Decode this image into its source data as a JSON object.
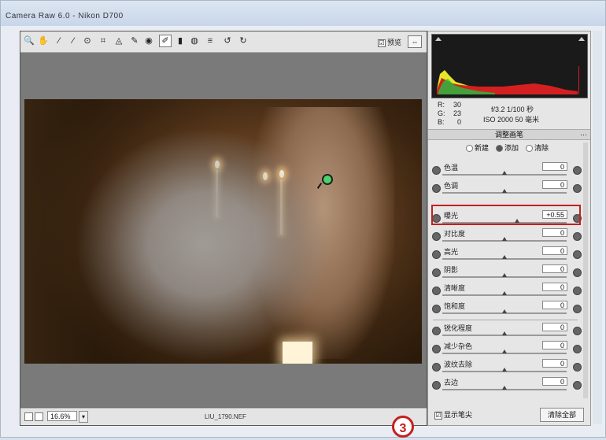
{
  "window": {
    "title": "Camera Raw 6.0 - Nikon D700"
  },
  "toolbar": {
    "tools": [
      {
        "icon": "zoom-icon",
        "glyph": "🔍"
      },
      {
        "icon": "hand-icon",
        "glyph": "✋"
      },
      {
        "icon": "white-balance-icon",
        "glyph": "⁄"
      },
      {
        "icon": "color-sampler-icon",
        "glyph": "⁄"
      },
      {
        "icon": "targeted-adjust-icon",
        "glyph": "⊙"
      },
      {
        "icon": "crop-icon",
        "glyph": "⌗"
      },
      {
        "icon": "straighten-icon",
        "glyph": "◬"
      },
      {
        "icon": "spot-removal-icon",
        "glyph": "✎"
      },
      {
        "icon": "red-eye-icon",
        "glyph": "◉"
      },
      {
        "icon": "adjustment-brush-icon",
        "glyph": "✐"
      },
      {
        "icon": "graduated-filter-icon",
        "glyph": "▮"
      },
      {
        "icon": "presets-icon",
        "glyph": "◍"
      },
      {
        "icon": "list-icon",
        "glyph": "≡"
      },
      {
        "icon": "rotate-ccw-icon",
        "glyph": "↺"
      },
      {
        "icon": "rotate-cw-icon",
        "glyph": "↻"
      }
    ],
    "preview_label": "预览",
    "preview_checked": "☑"
  },
  "status": {
    "zoom": "16.6%",
    "filename": "LIU_1790.NEF"
  },
  "info": {
    "r_label": "R:",
    "r_value": "30",
    "g_label": "G:",
    "g_value": "23",
    "b_label": "B:",
    "b_value": "0",
    "aperture_shutter": "f/3.2  1/100 秒",
    "iso_lens": "ISO 2000  50 毫米"
  },
  "panel": {
    "section_title": "调整画笔",
    "modes": [
      "新建",
      "添加",
      "清除"
    ],
    "sliders": [
      {
        "label": "色温",
        "value": "0",
        "pos": 0.5
      },
      {
        "label": "色调",
        "value": "0",
        "pos": 0.5
      },
      {
        "label": "曝光",
        "value": "+0.55",
        "pos": 0.6
      },
      {
        "label": "对比度",
        "value": "0",
        "pos": 0.5
      },
      {
        "label": "高光",
        "value": "0",
        "pos": 0.5
      },
      {
        "label": "阴影",
        "value": "0",
        "pos": 0.5
      },
      {
        "label": "清晰度",
        "value": "0",
        "pos": 0.5
      },
      {
        "label": "饱和度",
        "value": "0",
        "pos": 0.5
      },
      {
        "label": "锐化程度",
        "value": "0",
        "pos": 0.5
      },
      {
        "label": "减少杂色",
        "value": "0",
        "pos": 0.5
      },
      {
        "label": "波纹去除",
        "value": "0",
        "pos": 0.5
      },
      {
        "label": "去边",
        "value": "0",
        "pos": 0.5
      }
    ],
    "show_pins_label": "显示笔尖",
    "show_pins_checked": "☑",
    "clear_all_label": "清除全部"
  },
  "annotation": {
    "step": "3"
  }
}
